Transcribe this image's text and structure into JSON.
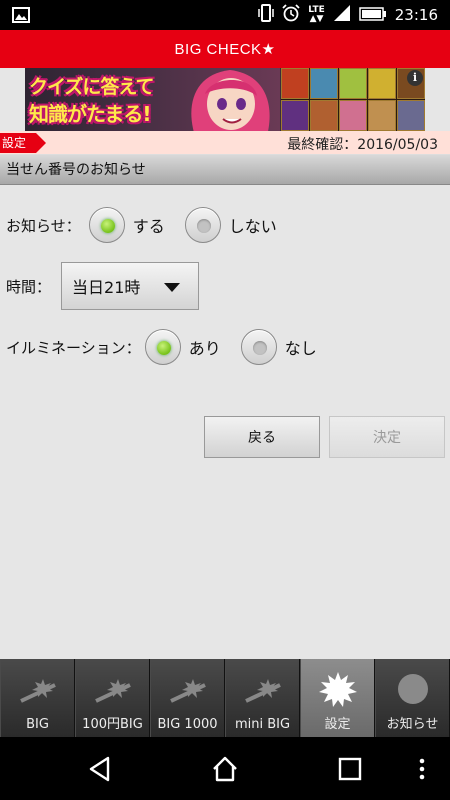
{
  "status_bar": {
    "time": "23:16",
    "network": "LTE"
  },
  "title": "BIG CHECK★",
  "ad": {
    "line1": "クイズに答えて",
    "line2": "知識がたまる!",
    "info": "i"
  },
  "breadcrumb": {
    "tag": "設定",
    "last_checked": "最終確認：2016/05/03"
  },
  "section_title": "当せん番号のお知らせ",
  "notify": {
    "label": "お知らせ：",
    "options": [
      {
        "label": "する",
        "selected": true
      },
      {
        "label": "しない",
        "selected": false
      }
    ]
  },
  "time_setting": {
    "label": "時間：",
    "value": "当日21時"
  },
  "illumination": {
    "label": "イルミネーション：",
    "options": [
      {
        "label": "あり",
        "selected": true
      },
      {
        "label": "なし",
        "selected": false
      }
    ]
  },
  "buttons": {
    "back": "戻る",
    "decide": "決定"
  },
  "tabs": [
    {
      "label": "BIG",
      "icon": "ball-burst-icon"
    },
    {
      "label": "100円BIG",
      "icon": "ball-burst-icon"
    },
    {
      "label": "BIG 1000",
      "icon": "ball-burst-icon"
    },
    {
      "label": "mini BIG",
      "icon": "ball-burst-icon"
    },
    {
      "label": "設定",
      "icon": "starburst-icon",
      "active": true
    },
    {
      "label": "お知らせ",
      "icon": "circle-icon"
    }
  ],
  "colors": {
    "brand_red": "#e60012",
    "radio_on": "#77c21a"
  }
}
